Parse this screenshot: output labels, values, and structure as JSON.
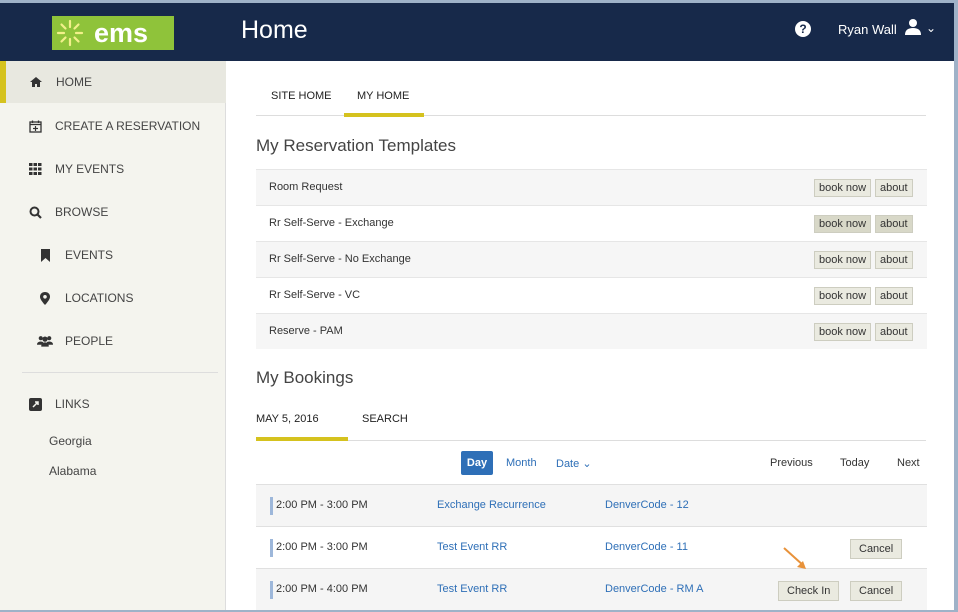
{
  "header": {
    "logo_text": "ems",
    "page_title": "Home",
    "help_glyph": "?",
    "user_name": "Ryan Wall",
    "colors": {
      "bar": "#17294a",
      "logo_green": "#8fc33a"
    }
  },
  "sidebar": {
    "items": [
      {
        "label": "HOME",
        "icon": "home-icon",
        "active": true
      },
      {
        "label": "CREATE A RESERVATION",
        "icon": "calendar-plus-icon"
      },
      {
        "label": "MY EVENTS",
        "icon": "grid-icon"
      },
      {
        "label": "BROWSE",
        "icon": "search-icon"
      },
      {
        "label": "EVENTS",
        "icon": "bookmark-icon"
      },
      {
        "label": "LOCATIONS",
        "icon": "map-marker-icon"
      },
      {
        "label": "PEOPLE",
        "icon": "users-icon"
      },
      {
        "label": "LINKS",
        "icon": "external-link-icon"
      }
    ],
    "links": [
      "Georgia",
      "Alabama"
    ]
  },
  "tabs": [
    {
      "label": "SITE HOME",
      "active": false
    },
    {
      "label": "MY HOME",
      "active": true
    }
  ],
  "templates": {
    "title": "My Reservation Templates",
    "book_label": "book now",
    "about_label": "about",
    "rows": [
      "Room Request",
      "Rr Self-Serve - Exchange",
      "Rr Self-Serve - No Exchange",
      "Rr Self-Serve - VC",
      "Reserve - PAM"
    ]
  },
  "bookings": {
    "title": "My Bookings",
    "tabs": [
      {
        "label": "MAY 5, 2016",
        "active": true
      },
      {
        "label": "SEARCH",
        "active": false
      }
    ],
    "views": {
      "day": "Day",
      "month": "Month",
      "date": "Date"
    },
    "nav": {
      "previous": "Previous",
      "today": "Today",
      "next": "Next"
    },
    "rows": [
      {
        "time": "2:00 PM - 3:00 PM",
        "event": "Exchange Recurrence",
        "code": "DenverCode - 12"
      },
      {
        "time": "2:00 PM - 3:00 PM",
        "event": "Test Event RR",
        "code": "DenverCode - 11",
        "cancel": "Cancel"
      },
      {
        "time": "2:00 PM - 4:00 PM",
        "event": "Test Event RR",
        "code": "DenverCode - RM A",
        "checkin": "Check In",
        "cancel": "Cancel"
      }
    ]
  },
  "accent": "#d5c21e",
  "link_color": "#2e6fb7"
}
